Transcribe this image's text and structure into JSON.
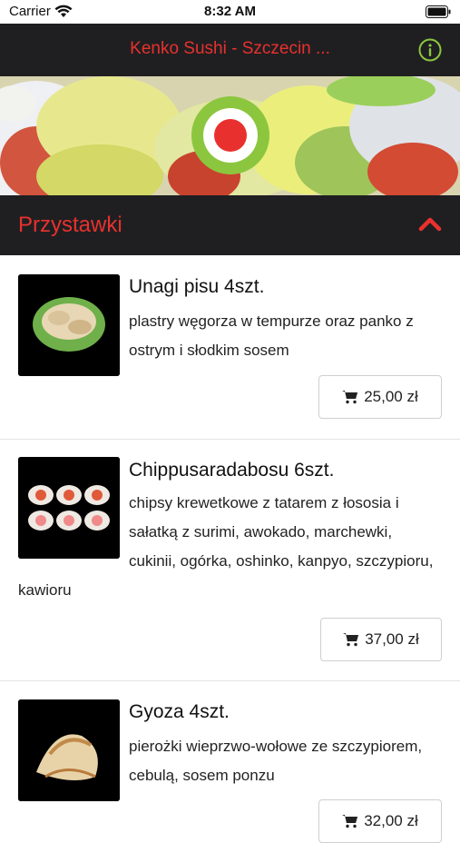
{
  "status_bar": {
    "carrier": "Carrier",
    "time": "8:32 AM"
  },
  "header": {
    "title": "Kenko Sushi - Szczecin ..."
  },
  "category": {
    "label": "Przystawki"
  },
  "items": [
    {
      "name": "Unagi pisu 4szt.",
      "description": "plastry węgorza w tempurze oraz panko z ostrym i słodkim sosem",
      "price": "25,00 zł"
    },
    {
      "name": "Chippusaradabosu 6szt.",
      "description": "chipsy krewetkowe z tatarem z łososia i sałatką z surimi, awokado, marchewki, cukinii, ogórka, oshinko, kanpyo, szczypioru, kawioru",
      "price": "37,00 zł"
    },
    {
      "name": "Gyoza 4szt.",
      "description": "pierożki wieprzwo-wołowe ze szczypiorem, cebulą, sosem ponzu",
      "price": "32,00 zł"
    }
  ],
  "colors": {
    "accent": "#e8312e",
    "bar": "#1f1f21",
    "info": "#8cc63f",
    "logo_ring": "#8cc63f"
  }
}
